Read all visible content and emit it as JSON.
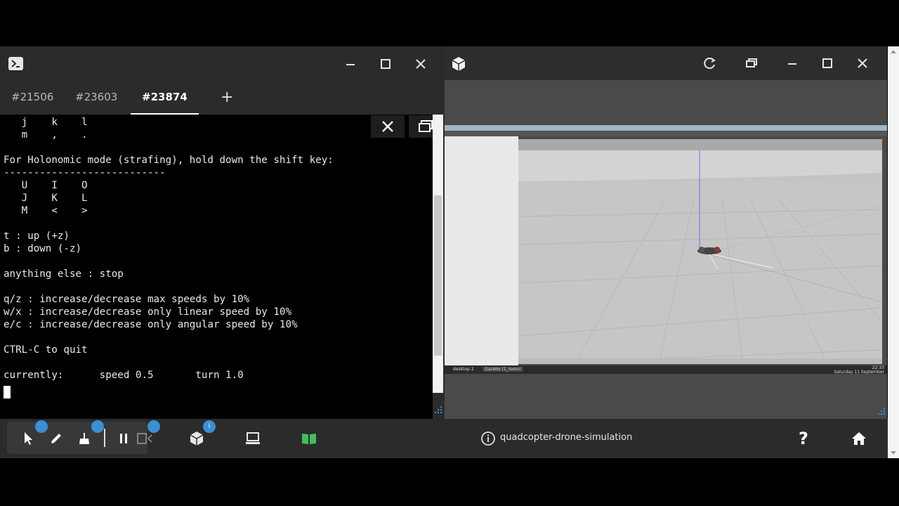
{
  "terminal": {
    "tabs": [
      "#21506",
      "#23603",
      "#23874"
    ],
    "add_tab": "+",
    "lines": [
      "   j    k    l",
      "   m    ,    .",
      "",
      "For Holonomic mode (strafing), hold down the shift key:",
      "---------------------------",
      "   U    I    O",
      "   J    K    L",
      "   M    <    >",
      "",
      "t : up (+z)",
      "b : down (-z)",
      "",
      "anything else : stop",
      "",
      "q/z : increase/decrease max speeds by 10%",
      "w/x : increase/decrease only linear speed by 10%",
      "e/c : increase/decrease only angular speed by 10%",
      "",
      "CTRL-C to quit",
      "",
      "currently:      speed 0.5       turn 1.0"
    ]
  },
  "sim": {
    "taskbar_left": "desktop 2",
    "taskbar_app": "Gazebo (1_room)",
    "taskbar_clock": "22:33",
    "taskbar_date": "Saturday 11 September"
  },
  "dock": {
    "app_name": "quadcopter-drone-simulation",
    "help": "?",
    "badge_value": "i"
  },
  "colors": {
    "accent": "#3a8fd6",
    "terminal_bg": "#000000",
    "chrome": "#2b2b2b",
    "green_icon": "#3fbf5a"
  }
}
